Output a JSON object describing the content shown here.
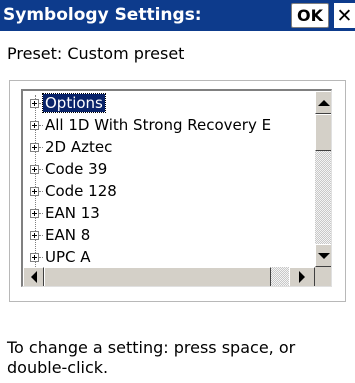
{
  "window": {
    "title": "Symbology Settings:",
    "ok_label": "OK",
    "close_label": "✕",
    "title_bar_color": "#0d3b8c"
  },
  "preset": {
    "text": "Preset: Custom preset"
  },
  "tree": {
    "items": [
      {
        "label": "Options",
        "selected": true
      },
      {
        "label": "All 1D With Strong Recovery E",
        "selected": false
      },
      {
        "label": "2D Aztec",
        "selected": false
      },
      {
        "label": "Code 39",
        "selected": false
      },
      {
        "label": "Code 128",
        "selected": false
      },
      {
        "label": "EAN 13",
        "selected": false
      },
      {
        "label": "EAN 8",
        "selected": false
      },
      {
        "label": "UPC A",
        "selected": false
      }
    ],
    "selection_color": "#0a246a"
  },
  "help": {
    "text": "To change a setting: press space, or double-click."
  }
}
